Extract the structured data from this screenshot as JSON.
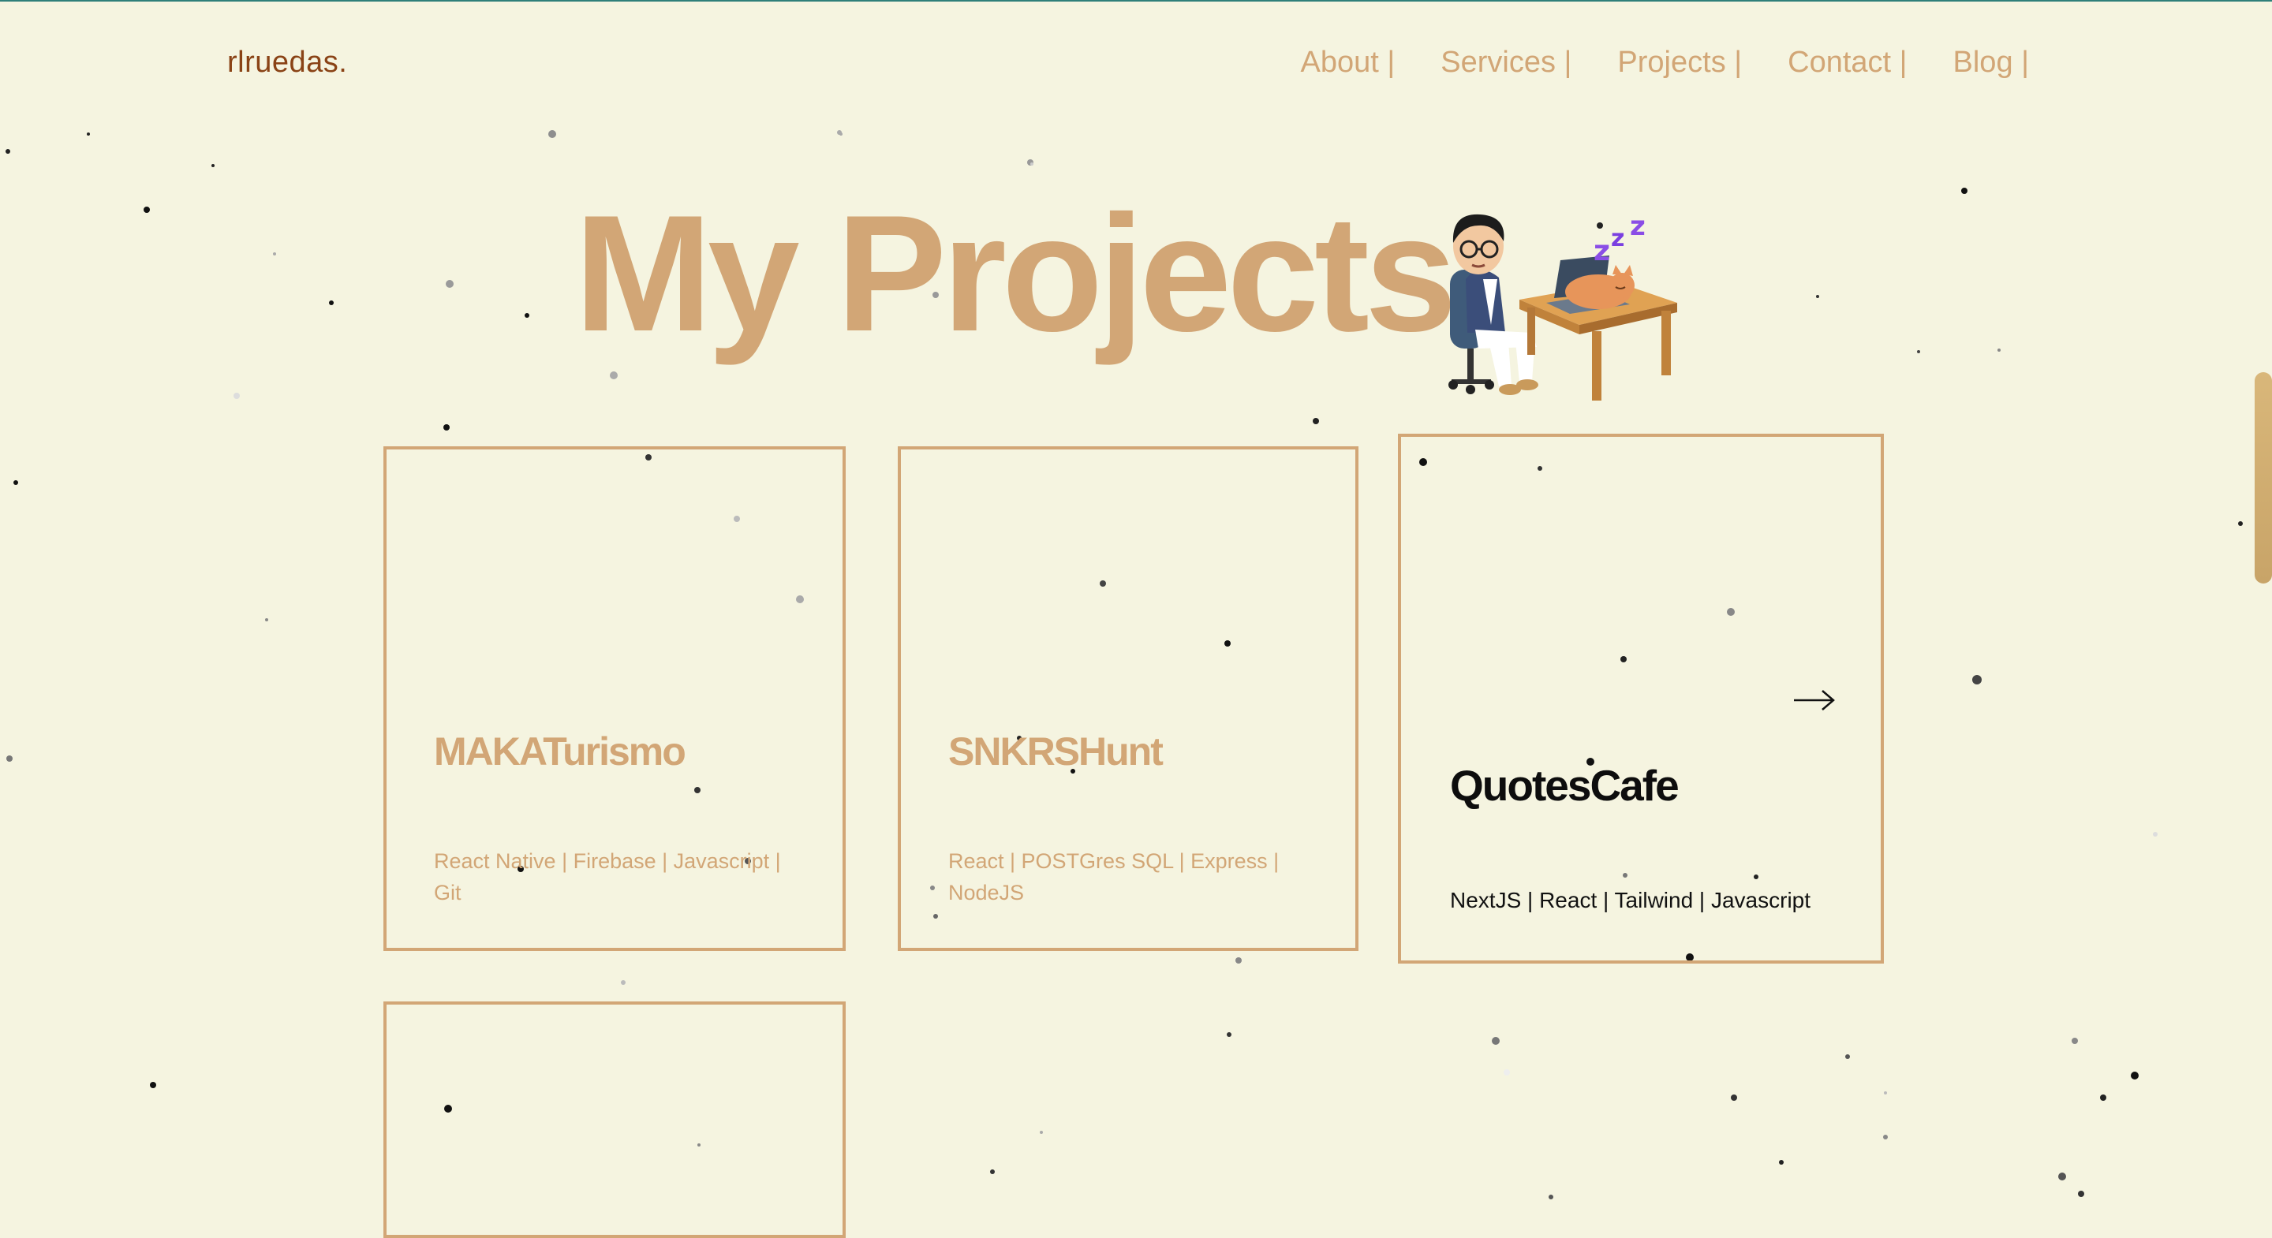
{
  "brand": "rlruedas.",
  "nav": {
    "about": "About |",
    "services": "Services |",
    "projects": "Projects |",
    "contact": "Contact |",
    "blog": "Blog |"
  },
  "hero": {
    "title": "My Projects"
  },
  "projects": [
    {
      "title": "MAKATurismo",
      "tech": "React Native | Firebase | Javascript | Git"
    },
    {
      "title": "SNKRSHunt",
      "tech": "React | POSTGres SQL | Express | NodeJS"
    },
    {
      "title": "QuotesCafe",
      "tech": "NextJS | React | Tailwind | Javascript"
    },
    {
      "title": "",
      "tech": ""
    }
  ],
  "icons": {
    "arrow": "arrow-right-icon",
    "avatar": "avatar-illustration"
  },
  "colors": {
    "background": "#f5f4e0",
    "accent": "#d2a676",
    "brand": "#8a4316"
  }
}
